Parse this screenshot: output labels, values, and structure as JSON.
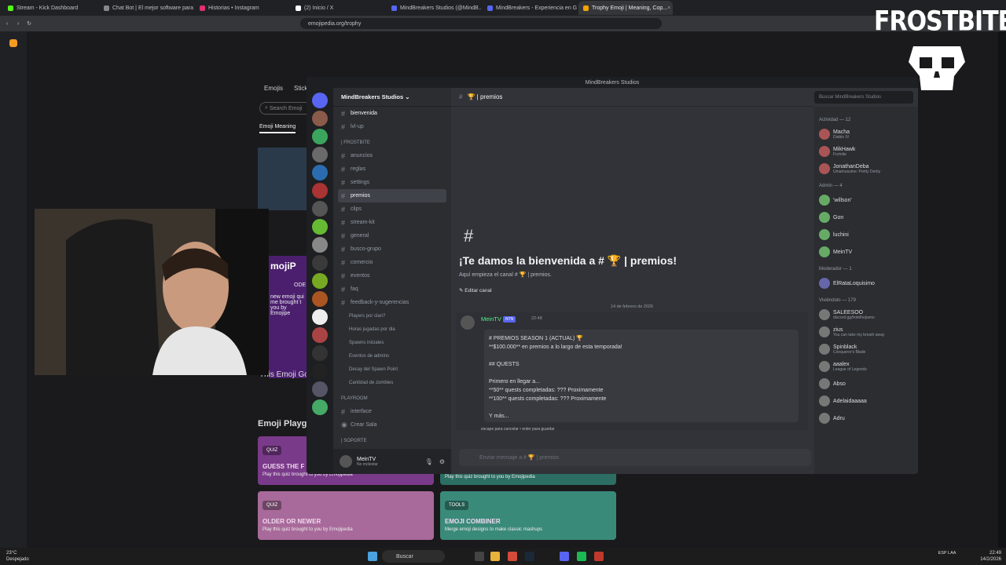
{
  "browser": {
    "tabs": [
      {
        "label": "Stream - Kick Dashboard",
        "color": "#53fc18"
      },
      {
        "label": "Chat Bot | El mejor software para pc",
        "color": "#888888"
      },
      {
        "label": "Historias • Instagram",
        "color": "#e1306c"
      },
      {
        "label": "(2) Inicio / X",
        "color": "#ffffff"
      },
      {
        "label": "MindBreakers Studios (@MindB...",
        "color": "#5865f2"
      },
      {
        "label": "MindBreakers - Experiencia en Game",
        "color": "#5865f2"
      },
      {
        "label": "Trophy Emoji | Meaning, Cop...",
        "color": "#f4a300"
      }
    ],
    "url": "emojipedia.org/trophy"
  },
  "emojipedia": {
    "tabs": [
      "Emojis",
      "Stick"
    ],
    "search_placeholder": "Search Emoji",
    "meaning_tab": "Emoji Meaning",
    "purple_big": "mojiP",
    "purple_small": "ODE",
    "purple_lines": [
      "new emoji qui",
      "me brought t",
      "you by Emojipe"
    ],
    "gold_text": "This Emoji Go",
    "playground": "Emoji Playg",
    "cards": [
      {
        "tag": "QUIZ",
        "title": "GUESS THE F",
        "desc": "Play this quiz brought to you by Emojipedia"
      },
      {
        "tag": "",
        "title": "",
        "desc": "Play this quiz brought to you by Emojipedia"
      },
      {
        "tag": "QUIZ",
        "title": "OLDER OR NEWER",
        "desc": "Play this quiz brought to you by Emojipedia"
      },
      {
        "tag": "TOOLS",
        "title": "EMOJI COMBINER",
        "desc": "Merge emoji designs to make classic mashups"
      }
    ]
  },
  "overlay": {
    "brand": "FROSTBITE"
  },
  "discord": {
    "window_title": "MindBreakers Studios",
    "server_name": "MindBreakers Studios",
    "channels_top": [
      {
        "label": "bienvenida",
        "selected": true
      },
      {
        "label": "lvl-up",
        "selected": false
      }
    ],
    "cat_frostbite": "| FROSTBITE",
    "channels_frostbite": [
      {
        "label": "anuncios"
      },
      {
        "label": "reglas"
      },
      {
        "label": "settings"
      },
      {
        "label": "premios",
        "active": true
      },
      {
        "label": "clips"
      },
      {
        "label": "stream-kit"
      },
      {
        "label": "general"
      },
      {
        "label": "busco-grupo"
      },
      {
        "label": "comercio"
      },
      {
        "label": "eventos"
      },
      {
        "label": "faq"
      },
      {
        "label": "feedback-y-sugerencias"
      }
    ],
    "events": [
      "Players por clan?",
      "Horas jugadas por dia",
      "Spawns iniciales",
      "Eventos de admins",
      "Decay del Spawn Point",
      "Cantidad de zombies"
    ],
    "cat_playroom": "PLAYROOM",
    "channels_playroom": [
      "interface",
      "Crear Sala"
    ],
    "cat_soporte": "| SOPORTE",
    "user": {
      "name": "MeinTV",
      "status": "No molestar"
    },
    "chat_channel": "premios",
    "search_placeholder": "Buscar MindBreakers Studios",
    "welcome_title": "¡Te damos la bienvenida a # 🏆 | premios!",
    "welcome_sub": "Aquí empieza el canal # 🏆 | premios.",
    "edit_channel": "Editar canal",
    "date": "14 de febrero de 2026",
    "message": {
      "author": "MeinTV",
      "badge": "NTN",
      "time": "22:48",
      "lines": [
        "# PREMIOS SEASON 1 (ACTUAL) 🏆",
        "**$100.000** en premios a lo largo de esta temporada!",
        "",
        "## QUESTS",
        "",
        "Primero en llegar a...",
        "**50** quests completadas: ??? Proximamente",
        "**100** quests completadas: ??? Proximamente",
        "",
        "Y más..."
      ],
      "hint": "escape para cancelar • enter para guardar"
    },
    "composer_placeholder": "Enviar mensaje a # 🏆 | premios",
    "activity_header": "Actividad — 12",
    "activity": [
      {
        "name": "Macha",
        "game": "Diablo IV"
      },
      {
        "name": "MikHawk",
        "game": "Fortnite"
      },
      {
        "name": "JonathanDeba",
        "game": "Umamusume: Pretty Derby"
      }
    ],
    "admin_header": "Admin — 4",
    "admins": [
      "'willson'",
      "Gon",
      "luchini",
      "MeinTV"
    ],
    "mod_header": "Moderador — 1",
    "mods": [
      "ElRataLoquisimo"
    ],
    "online_header": "Viviéndolo — 179",
    "online": [
      {
        "name": "SALEESOO",
        "status": "discord.gg/hotelhejiamo"
      },
      {
        "name": "zius",
        "status": "You can take my breath away"
      },
      {
        "name": "Spinblack",
        "status": "Conqueror's Blade"
      },
      {
        "name": "aaalex",
        "status": "League of Legends"
      },
      {
        "name": "Abso",
        "status": ""
      },
      {
        "name": "Adelaidaaaaa",
        "status": ""
      },
      {
        "name": "Adru",
        "status": ""
      }
    ]
  },
  "taskbar": {
    "weather_temp": "23°C",
    "weather_desc": "Despejado",
    "search": "Buscar",
    "lang": "ESP LAA",
    "time": "22:49",
    "date": "14/2/2026"
  },
  "colors": {
    "discord_bg": "#313338",
    "accent": "#5865f2"
  }
}
